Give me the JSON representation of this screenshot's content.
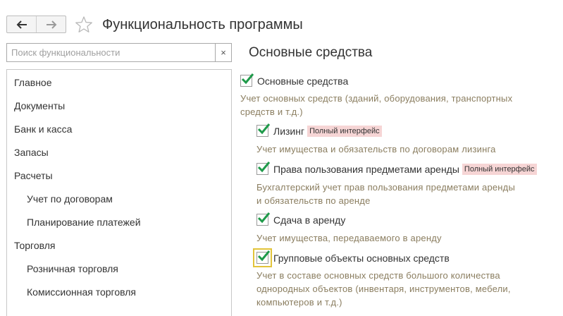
{
  "header": {
    "title": "Функциональность программы",
    "back_icon": "arrow-left-icon",
    "forward_icon": "arrow-right-icon",
    "favorite_icon": "star-icon"
  },
  "search": {
    "placeholder": "Поиск функциональности",
    "value": "",
    "clear_label": "×"
  },
  "sidebar": {
    "items": [
      {
        "label": "Главное"
      },
      {
        "label": "Документы"
      },
      {
        "label": "Банк и касса"
      },
      {
        "label": "Запасы"
      },
      {
        "label": "Расчеты"
      },
      {
        "label": "Учет по договорам"
      },
      {
        "label": "Планирование платежей"
      },
      {
        "label": "Торговля"
      },
      {
        "label": "Розничная торговля"
      },
      {
        "label": "Комиссионная торговля"
      }
    ]
  },
  "main": {
    "section_title": "Основные средства",
    "options": [
      {
        "label": "Основные средства",
        "checked": true,
        "badge": "",
        "description": [
          "Учет основных средств (зданий, оборудования, транспортных",
          "средств и т.д.)"
        ]
      },
      {
        "label": "Лизинг",
        "checked": true,
        "badge": "Полный интерфейс",
        "description": [
          "Учет имущества и обязательств  по договорам лизинга"
        ]
      },
      {
        "label": "Права пользования предметами аренды",
        "checked": true,
        "badge": "Полный интерфейс",
        "description": [
          "Бухгалтерский учет прав пользования предметами аренды",
          "и обязательств по аренде"
        ]
      },
      {
        "label": "Сдача в аренду",
        "checked": true,
        "badge": "",
        "description": [
          "Учет имущества, передаваемого в аренду"
        ]
      },
      {
        "label": "Групповые объекты основных средств",
        "checked": true,
        "badge": "",
        "description": [
          "Учет в составе основных средств большого количества",
          "однородных объектов (инвентаря, инструментов, мебели,",
          "компьютеров и т.д.)"
        ]
      }
    ]
  },
  "colors": {
    "check": "#1f9a4a",
    "description": "#8a7d5f",
    "badge_bg": "#f6d5d5",
    "focus": "#e2c43a"
  }
}
